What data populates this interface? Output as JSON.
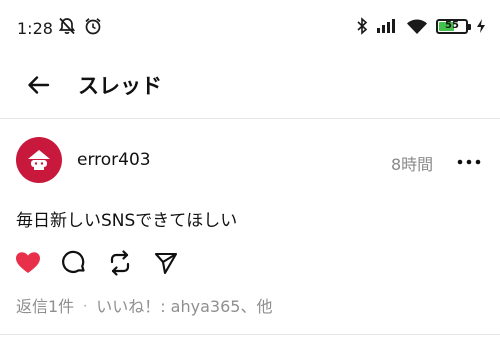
{
  "status_bar": {
    "time": "1:28",
    "battery_level": "55",
    "battery_color": "#43c24b",
    "icons_left": [
      "mute-icon",
      "alarm-icon"
    ],
    "icons_right": [
      "bluetooth-icon",
      "signal-icon",
      "wifi-icon",
      "battery-icon",
      "charging-icon"
    ]
  },
  "header": {
    "back_icon": "arrow-left-icon",
    "title": "スレッド"
  },
  "post": {
    "avatar_color": "#c8193c",
    "username": "error403",
    "timestamp": "8時間",
    "more_icon": "more-horizontal-icon",
    "text": "毎日新しいSNSできてほしい",
    "actions": [
      {
        "name": "like-button",
        "icon": "heart-icon",
        "color": "#e8304a",
        "liked": true
      },
      {
        "name": "reply-button",
        "icon": "comment-icon"
      },
      {
        "name": "repost-button",
        "icon": "repost-icon"
      },
      {
        "name": "share-button",
        "icon": "send-icon"
      }
    ],
    "replies": "返信1件",
    "separator": "·",
    "likes": "いいね！: ahya365、他"
  }
}
